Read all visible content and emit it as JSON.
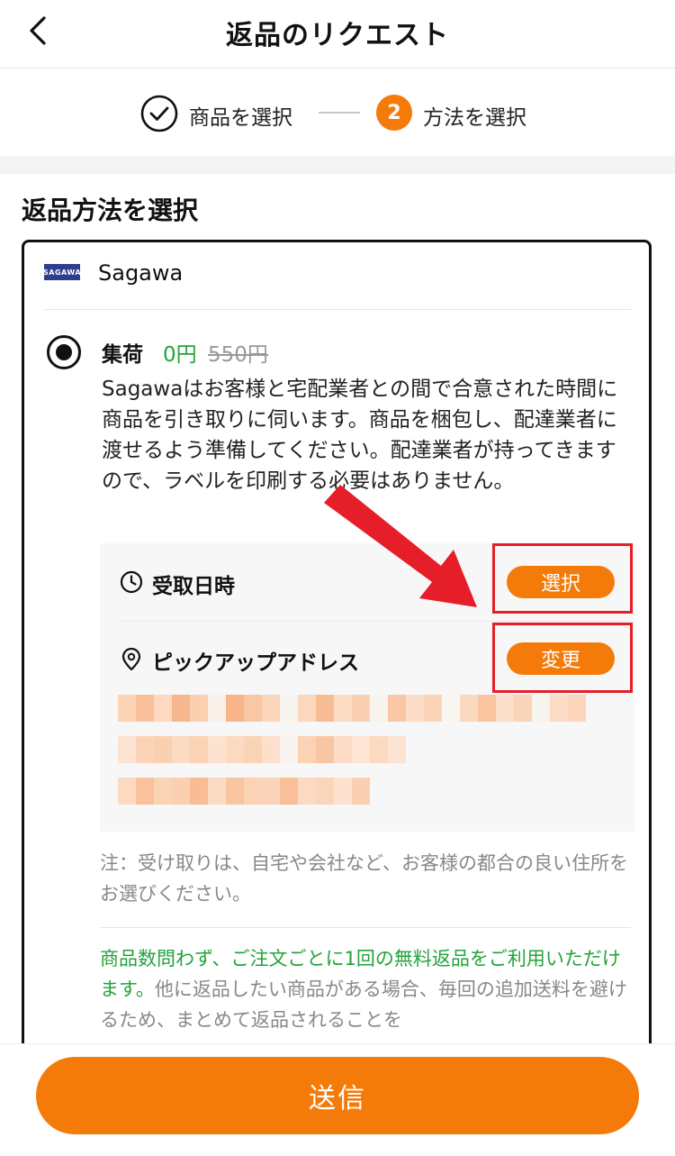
{
  "header": {
    "title": "返品のリクエスト",
    "back_icon": "chevron-left-icon"
  },
  "stepper": {
    "steps": [
      {
        "label": "商品を選択",
        "state": "done",
        "icon": "check-circle-icon"
      },
      {
        "number": "2",
        "label": "方法を選択",
        "state": "current"
      }
    ]
  },
  "section": {
    "title": "返品方法を選択"
  },
  "carrier": {
    "logo_text": "SAGAWA",
    "name": "Sagawa"
  },
  "method": {
    "name": "集荷",
    "price": "0円",
    "original_price": "550円",
    "selected": true,
    "description": "Sagawaはお客様と宅配業者との間で合意された時間に商品を引き取りに伺います。商品を梱包し、配達業者に渡せるよう準備してください。配達業者が持ってきますので、ラベルを印刷する必要はありません。"
  },
  "pickup_time": {
    "label": "受取日時",
    "button_label": "選択",
    "icon": "clock-icon"
  },
  "pickup_address": {
    "label": "ピックアップアドレス",
    "button_label": "変更",
    "icon": "location-pin-icon"
  },
  "note": "注：受け取りは、自宅や会社など、お客様の都合の良い住所をお選びください。",
  "promo": {
    "highlight": "商品数問わず、ご注文ごとに1回の無料返品をご利用いただけます。",
    "rest": "他に返品したい商品がある場合、毎回の追加送料を避けるため、まとめて返品されることを"
  },
  "footer": {
    "submit_label": "送信"
  },
  "colors": {
    "accent": "#f47b0a",
    "success": "#23a33b",
    "annotation": "#e61e29",
    "logo": "#2e3d8f"
  }
}
